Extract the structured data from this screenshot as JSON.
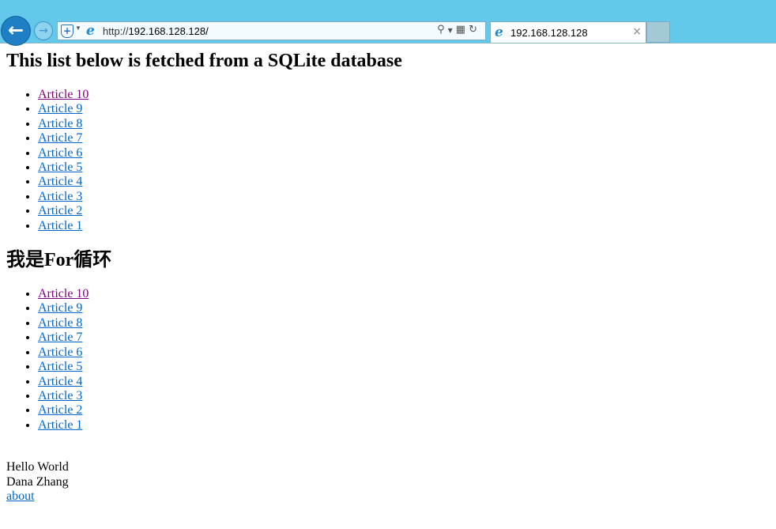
{
  "browser": {
    "url_prefix": "http://",
    "url_host": "192.168.128.128/",
    "tab_title": "192.168.128.128",
    "icons": [
      "back-icon",
      "forward-icon",
      "shield-icon",
      "ie-icon",
      "search-icon",
      "compat-icon",
      "refresh-icon",
      "close-icon"
    ]
  },
  "page": {
    "heading1": "This list below is fetched from a SQLite database",
    "list1": [
      "Article 10",
      "Article 9",
      "Article 8",
      "Article 7",
      "Article 6",
      "Article 5",
      "Article 4",
      "Article 3",
      "Article 2",
      "Article 1"
    ],
    "heading2": "我是For循环",
    "list2": [
      "Article 10",
      "Article 9",
      "Article 8",
      "Article 7",
      "Article 6",
      "Article 5",
      "Article 4",
      "Article 3",
      "Article 2",
      "Article 1"
    ],
    "footer": {
      "line1": "Hello World",
      "line2": "Dana Zhang",
      "link": "about"
    }
  }
}
